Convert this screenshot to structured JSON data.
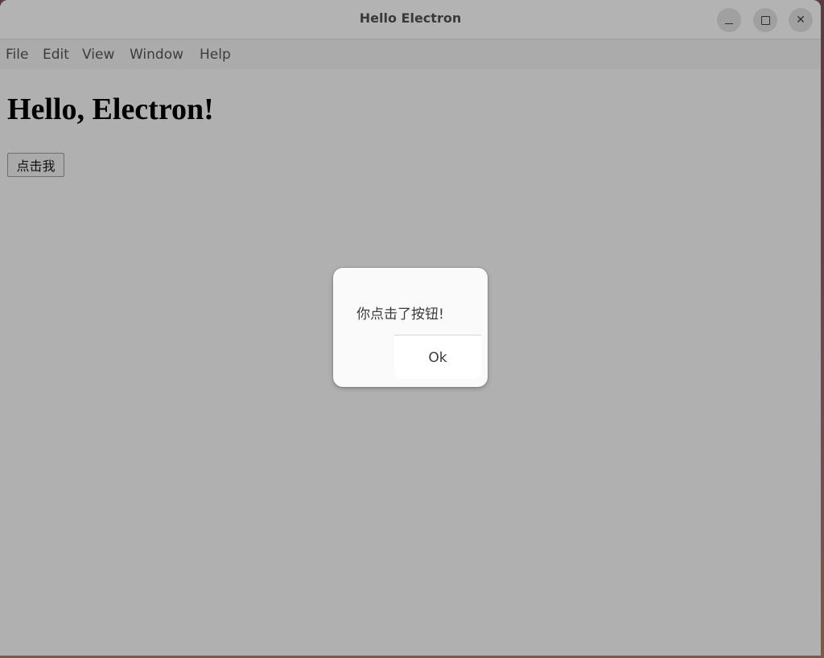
{
  "window": {
    "title": "Hello Electron",
    "controls": {
      "minimize_icon": "minimize-icon",
      "maximize_icon": "maximize-icon",
      "close_icon": "close-icon",
      "close_glyph": "✕"
    }
  },
  "menubar": {
    "items": [
      {
        "label": "File"
      },
      {
        "label": "Edit"
      },
      {
        "label": "View"
      },
      {
        "label": "Window"
      },
      {
        "label": "Help"
      }
    ]
  },
  "content": {
    "heading": "Hello, Electron!",
    "button_label": "点击我"
  },
  "dialog": {
    "message": "你点击了按钮!",
    "ok_label": "Ok"
  },
  "colors": {
    "overlay_gray": "#b0b0b0",
    "dialog_bg": "#fafafa"
  }
}
